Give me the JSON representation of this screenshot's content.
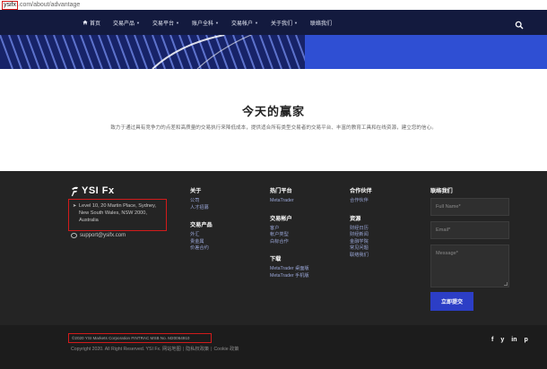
{
  "browser": {
    "host": "ysifx",
    "path": ".com/about/advantage"
  },
  "nav": {
    "items": [
      {
        "label": "首页",
        "icon": "home-icon",
        "caret": false
      },
      {
        "label": "交易产品",
        "caret": true
      },
      {
        "label": "交易平台",
        "caret": true
      },
      {
        "label": "账户全科",
        "caret": true
      },
      {
        "label": "交易帐户",
        "caret": true
      },
      {
        "label": "关于我们",
        "caret": true
      },
      {
        "label": "联络我们",
        "caret": false
      }
    ],
    "caret_glyph": "▼",
    "search_icon": "search-icon"
  },
  "hero": {
    "title": "今天的赢家",
    "description": "致力于通过具有竞争力的点差和高质量的交易执行来降低成本，提供适合所有类型交易者的交易平台、丰富的教育工具和在线资源，建立您的信心。"
  },
  "footer": {
    "logo_text": "YSI Fx",
    "address": {
      "pin_icon": "➤",
      "lines": [
        "Level 10, 20 Martin Place, Sydney,",
        "New South Wales, NSW 2000,",
        "Australia"
      ]
    },
    "email": "support@ysifx.com",
    "columns": {
      "about": {
        "title": "关于",
        "links": [
          "公司",
          "人才招募"
        ]
      },
      "products": {
        "title": "交易产品",
        "links": [
          "外汇",
          "贵金属",
          "价差合约"
        ]
      },
      "platforms": {
        "title": "热门平台",
        "links": [
          "MetaTrader"
        ]
      },
      "accounts": {
        "title": "交易帐户",
        "links": [
          "客户",
          "帐户类型",
          "白标合作"
        ]
      },
      "downloads": {
        "title": "下载",
        "links": [
          "MetaTrader 桌面版",
          "MetaTrader 手机版"
        ]
      },
      "partners": {
        "title": "合作伙伴",
        "links": [
          "合作伙伴"
        ]
      },
      "resources": {
        "title": "资源",
        "links": [
          "财经日历",
          "财经新闻",
          "金融学院",
          "常见问题",
          "联络我们"
        ]
      },
      "contact": {
        "title": "联络我们"
      }
    },
    "form": {
      "name_placeholder": "Full Name*",
      "email_placeholder": "Email*",
      "message_placeholder": "Message*",
      "submit_label": "立即提交"
    }
  },
  "bottom": {
    "regulation": "©2020 YSI Markets Corporation FINTRAC MSB No. M20064910",
    "copyright": "Copyright 2020. All Right Reserved. YSI Fx.",
    "links": [
      "网站地图",
      "隐私权政策",
      "Cookie 政策"
    ],
    "separator": "|",
    "social": [
      "f",
      "y",
      "in",
      "p"
    ]
  },
  "colors": {
    "nav_bg": "#131a3e",
    "banner_dark": "#172368",
    "banner_blue": "#2f4fd3",
    "footer_bg": "#242424",
    "bottom_bg": "#1c1c1c",
    "accent": "#2c3ec6",
    "highlight_box": "#d21b1b"
  }
}
